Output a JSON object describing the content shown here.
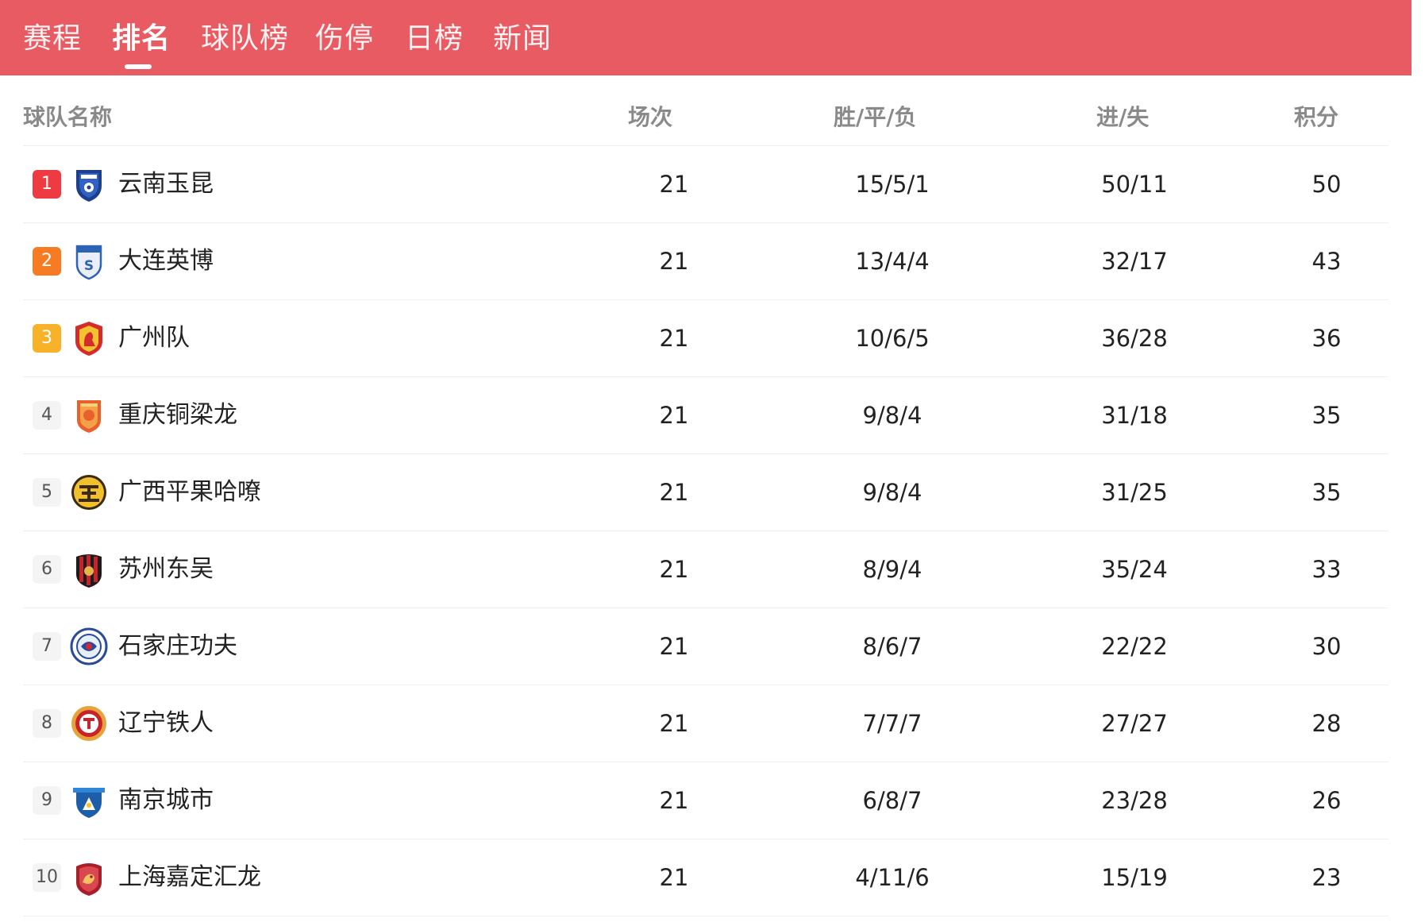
{
  "tabs": [
    {
      "label": "赛程",
      "active": false
    },
    {
      "label": "排名",
      "active": true
    },
    {
      "label": "球队榜",
      "active": false
    },
    {
      "label": "伤停",
      "active": false
    },
    {
      "label": "日榜",
      "active": false
    },
    {
      "label": "新闻",
      "active": false
    }
  ],
  "colors": {
    "tabbar_bg": "#e85b62",
    "rank1": "#ee3b42",
    "rank2": "#f77b22",
    "rank3": "#f7b22a",
    "header_text": "#8a8a8a"
  },
  "table": {
    "headers": {
      "team": "球队名称",
      "played": "场次",
      "wdl": "胜/平/负",
      "goals": "进/失",
      "points": "积分"
    },
    "rows": [
      {
        "rank": "1",
        "team": "云南玉昆",
        "logo": "yunnan-yukun-logo",
        "played": "21",
        "wdl": "15/5/1",
        "goals": "50/11",
        "points": "50"
      },
      {
        "rank": "2",
        "team": "大连英博",
        "logo": "dalian-yingbo-logo",
        "played": "21",
        "wdl": "13/4/4",
        "goals": "32/17",
        "points": "43"
      },
      {
        "rank": "3",
        "team": "广州队",
        "logo": "guangzhou-logo",
        "played": "21",
        "wdl": "10/6/5",
        "goals": "36/28",
        "points": "36"
      },
      {
        "rank": "4",
        "team": "重庆铜梁龙",
        "logo": "chongqing-tongliang-long-logo",
        "played": "21",
        "wdl": "9/8/4",
        "goals": "31/18",
        "points": "35"
      },
      {
        "rank": "5",
        "team": "广西平果哈嘹",
        "logo": "guangxi-pingguo-haliao-logo",
        "played": "21",
        "wdl": "9/8/4",
        "goals": "31/25",
        "points": "35"
      },
      {
        "rank": "6",
        "team": "苏州东吴",
        "logo": "suzhou-dongwu-logo",
        "played": "21",
        "wdl": "8/9/4",
        "goals": "35/24",
        "points": "33"
      },
      {
        "rank": "7",
        "team": "石家庄功夫",
        "logo": "shijiazhuang-gongfu-logo",
        "played": "21",
        "wdl": "8/6/7",
        "goals": "22/22",
        "points": "30"
      },
      {
        "rank": "8",
        "team": "辽宁铁人",
        "logo": "liaoning-tieren-logo",
        "played": "21",
        "wdl": "7/7/7",
        "goals": "27/27",
        "points": "28"
      },
      {
        "rank": "9",
        "team": "南京城市",
        "logo": "nanjing-city-logo",
        "played": "21",
        "wdl": "6/8/7",
        "goals": "23/28",
        "points": "26"
      },
      {
        "rank": "10",
        "team": "上海嘉定汇龙",
        "logo": "shanghai-jiading-huilong-logo",
        "played": "21",
        "wdl": "4/11/6",
        "goals": "15/19",
        "points": "23"
      }
    ]
  }
}
